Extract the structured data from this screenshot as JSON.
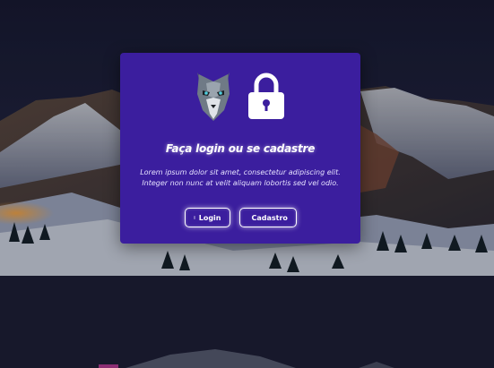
{
  "modal": {
    "title": "Faça login ou se cadastre",
    "text": "Lorem ipsum dolor sit amet, consectetur adipiscing elit. Integer non nunc at velit aliquam lobortis sed vel odio.",
    "buttons": {
      "login_label": "Login",
      "login_icon": "door-icon",
      "signup_label": "Cadastro",
      "signup_icon": "power-icon"
    },
    "logo_icons": [
      "wolf-logo-icon",
      "padlock-icon"
    ]
  },
  "colors": {
    "modal_bg": "#3b1e9e",
    "button_border": "#ffffff"
  }
}
